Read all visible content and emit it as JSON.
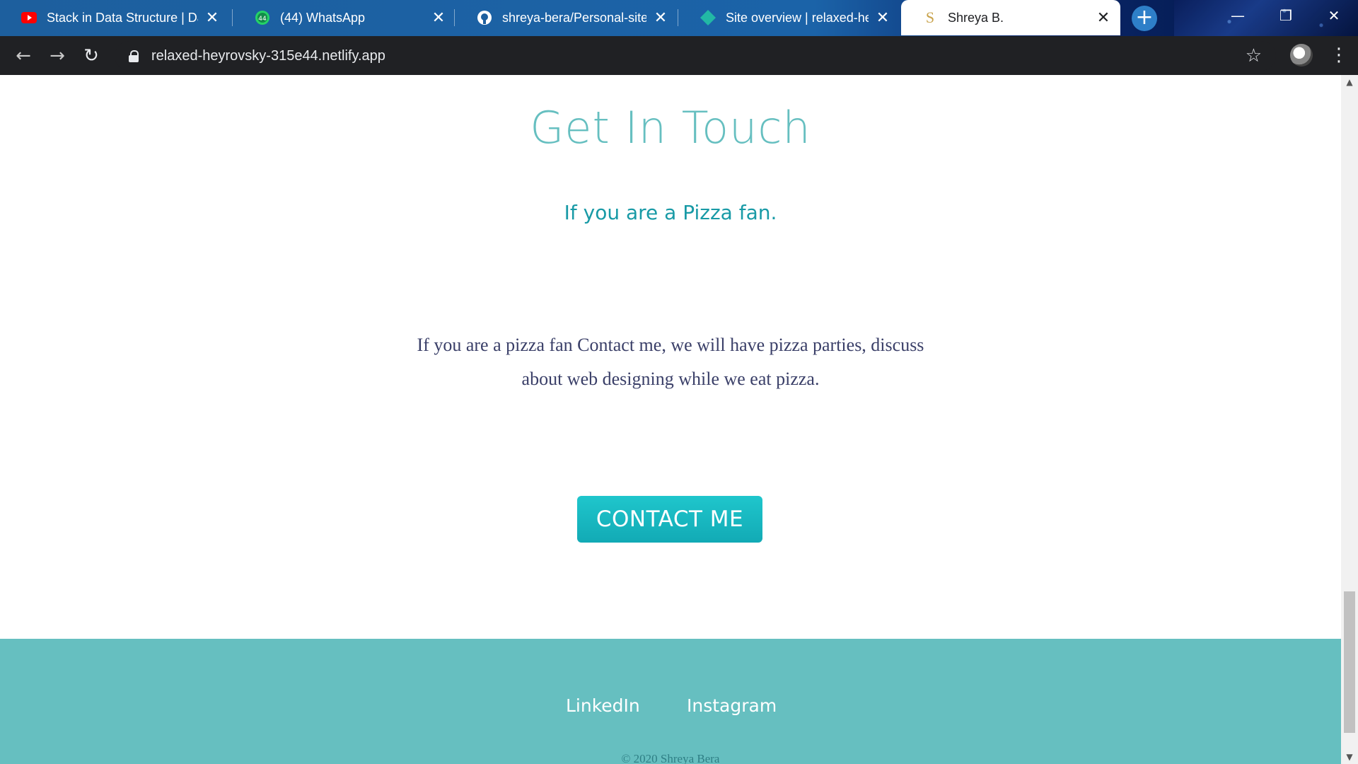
{
  "browser": {
    "tabs": [
      {
        "title": "Stack in Data Structure | Dat",
        "icon": "youtube-icon",
        "color": "#ff0000"
      },
      {
        "title": "(44) WhatsApp",
        "icon": "whatsapp-icon",
        "badge": "44",
        "color": "#25d366"
      },
      {
        "title": "shreya-bera/Personal-site",
        "icon": "github-icon"
      },
      {
        "title": "Site overview | relaxed-heyr",
        "icon": "netlify-icon",
        "color": "#22b8a5"
      },
      {
        "title": "Shreya B.",
        "icon": "site-s-icon",
        "glyph": "S",
        "active": true
      }
    ],
    "close_glyph": "✕",
    "new_tab_glyph": "+",
    "window_controls": {
      "minimize": "—",
      "restore": "❐",
      "close": "✕"
    },
    "nav": {
      "back": "←",
      "forward": "→",
      "reload": "↻"
    },
    "url": "relaxed-heyrovsky-315e44.netlify.app",
    "bookmark_glyph": "☆",
    "menu_glyph": "⋮"
  },
  "page": {
    "heading": "Get In Touch",
    "subheading": "If you are a Pizza fan.",
    "paragraph": "If you are a pizza fan Contact me, we will have pizza parties, discuss about web designing while we eat pizza.",
    "cta_label": "CONTACT ME",
    "footer": {
      "links": [
        "LinkedIn",
        "Instagram"
      ],
      "copyright": "© 2020 Shreya Bera"
    },
    "colors": {
      "accent": "#66bfc0",
      "subheading": "#189aa6",
      "button": "#1cbac2",
      "text": "#3a3f68"
    }
  },
  "scrollbar": {
    "up": "▲",
    "down": "▼",
    "position_fraction": 0.93
  }
}
